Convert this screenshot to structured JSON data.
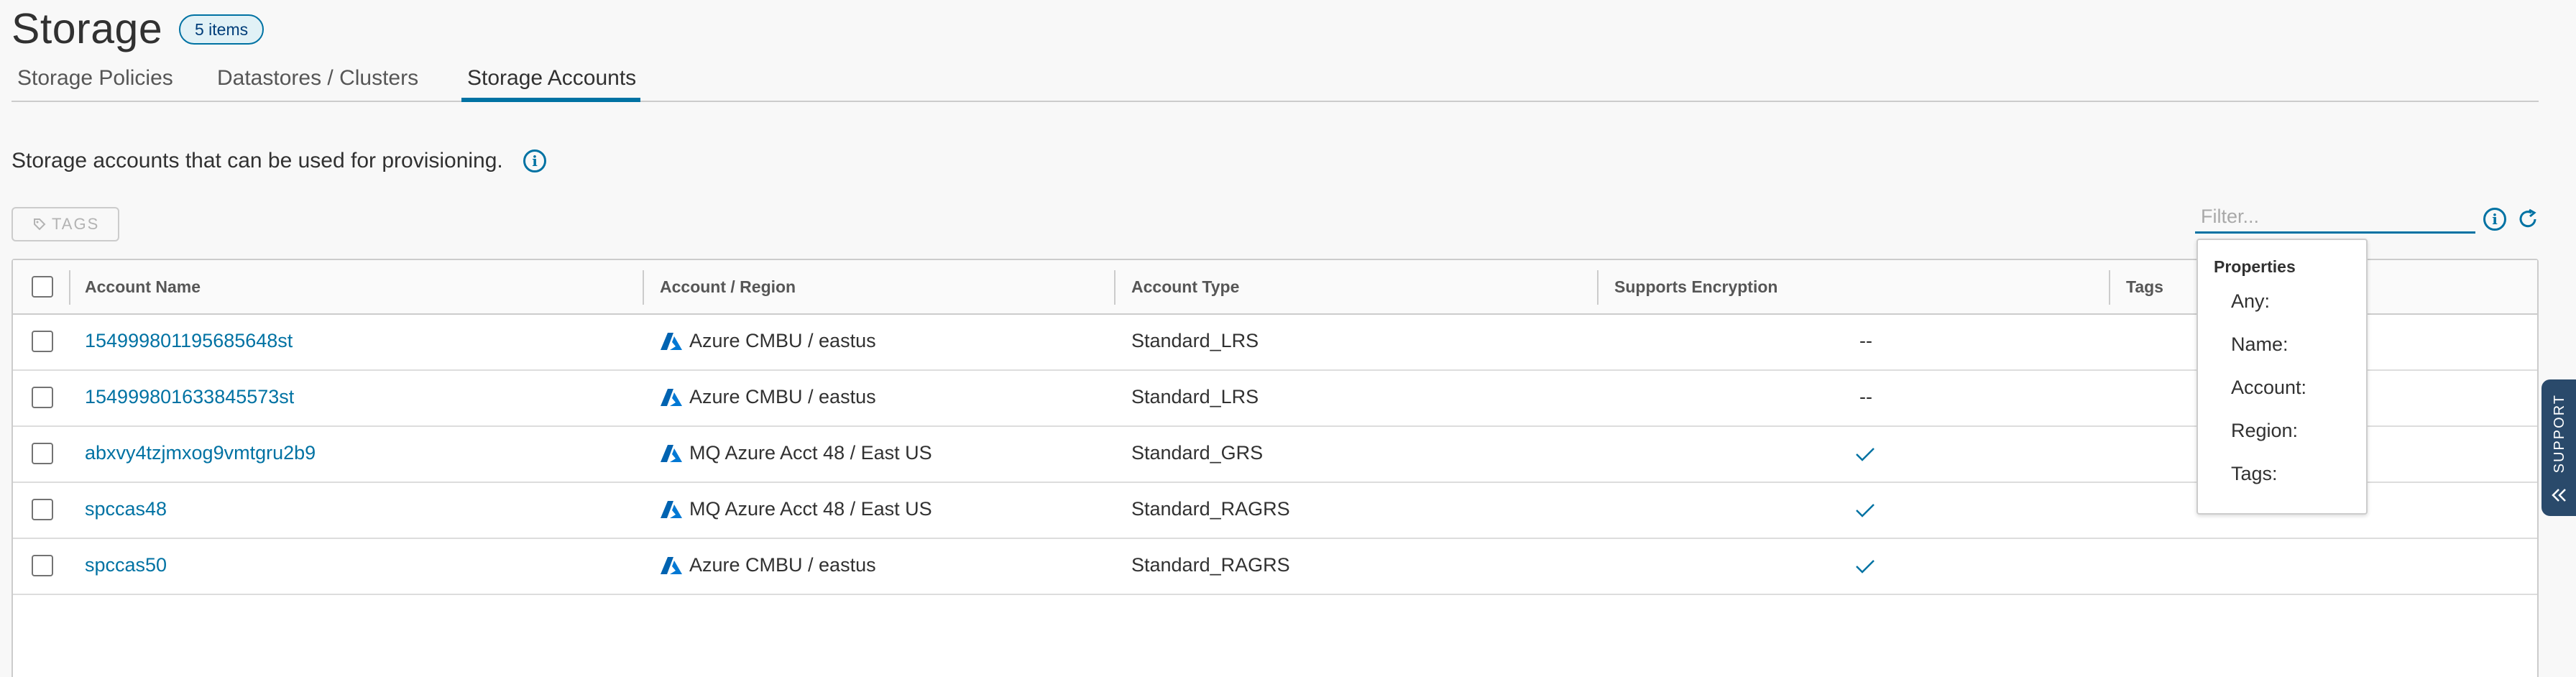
{
  "header": {
    "title": "Storage",
    "count_badge": "5 items"
  },
  "tabs": [
    {
      "label": "Storage Policies",
      "active": false
    },
    {
      "label": "Datastores / Clusters",
      "active": false
    },
    {
      "label": "Storage Accounts",
      "active": true
    }
  ],
  "description": "Storage accounts that can be used for provisioning.",
  "toolbar": {
    "tags_label": "TAGS",
    "filter_placeholder": "Filter..."
  },
  "grid": {
    "columns": [
      "Account Name",
      "Account / Region",
      "Account Type",
      "Supports Encryption",
      "Tags"
    ],
    "rows": [
      {
        "name": "154999801195685648st",
        "region": "Azure CMBU / eastus",
        "type": "Standard_LRS",
        "encryption": "--",
        "tags": ""
      },
      {
        "name": "154999801633845573st",
        "region": "Azure CMBU / eastus",
        "type": "Standard_LRS",
        "encryption": "--",
        "tags": ""
      },
      {
        "name": "abxvy4tzjmxog9vmtgru2b9",
        "region": "MQ Azure Acct 48 / East US",
        "type": "Standard_GRS",
        "encryption": "check",
        "tags": ""
      },
      {
        "name": "spccas48",
        "region": "MQ Azure Acct 48 / East US",
        "type": "Standard_RAGRS",
        "encryption": "check",
        "tags": ""
      },
      {
        "name": "spccas50",
        "region": "Azure CMBU / eastus",
        "type": "Standard_RAGRS",
        "encryption": "check",
        "tags": ""
      }
    ]
  },
  "filter_dropdown": {
    "header": "Properties",
    "items": [
      "Any:",
      "Name:",
      "Account:",
      "Region:",
      "Tags:"
    ]
  },
  "support_tab": {
    "label": "SUPPORT"
  },
  "colors": {
    "accent": "#0072a3",
    "azure_icon": "#0063b1",
    "support_bg": "#2a4a6b"
  },
  "icons": {
    "info": "info-circle-icon",
    "tag": "tag-icon",
    "refresh": "refresh-icon",
    "azure": "azure-icon",
    "check": "check-icon",
    "chevron": "double-chevron-left-icon"
  }
}
